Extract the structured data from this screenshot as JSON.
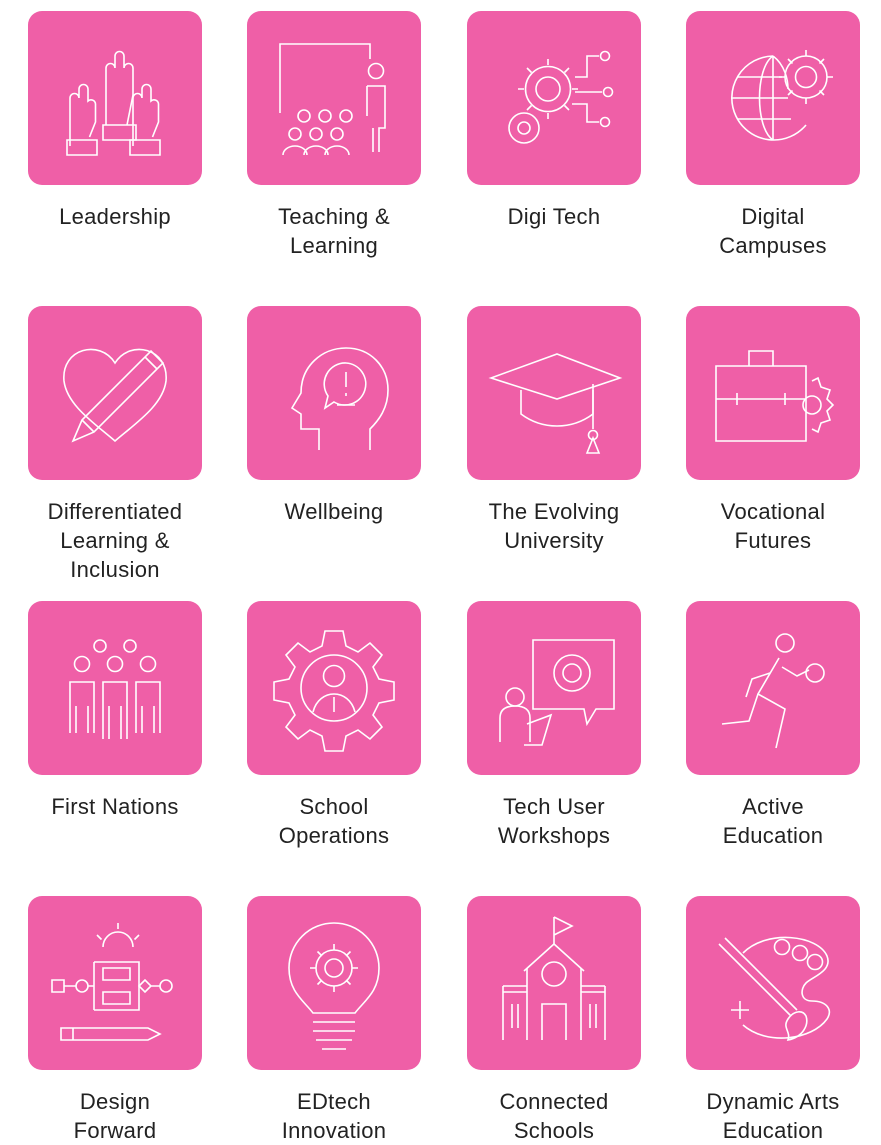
{
  "accent_color": "#ef5fa7",
  "tiles": [
    {
      "label": "Leadership",
      "icon": "raised-hands-icon"
    },
    {
      "label": "Teaching &\nLearning",
      "icon": "presentation-icon"
    },
    {
      "label": "Digi Tech",
      "icon": "gears-circuit-icon"
    },
    {
      "label": "Digital\nCampuses",
      "icon": "globe-gear-icon"
    },
    {
      "label": "Differentiated\nLearning &\nInclusion",
      "icon": "heart-pencil-icon"
    },
    {
      "label": "Wellbeing",
      "icon": "head-alert-icon"
    },
    {
      "label": "The Evolving\nUniversity",
      "icon": "graduation-cap-icon"
    },
    {
      "label": "Vocational\nFutures",
      "icon": "briefcase-gear-icon"
    },
    {
      "label": "First Nations",
      "icon": "people-group-icon"
    },
    {
      "label": "School\nOperations",
      "icon": "gear-person-icon"
    },
    {
      "label": "Tech User\nWorkshops",
      "icon": "presenter-gear-icon"
    },
    {
      "label": "Active\nEducation",
      "icon": "runner-icon"
    },
    {
      "label": "Design\nForward",
      "icon": "flowchart-icon"
    },
    {
      "label": "EDtech\nInnovation",
      "icon": "lightbulb-gear-icon"
    },
    {
      "label": "Connected\nSchools",
      "icon": "school-building-icon"
    },
    {
      "label": "Dynamic Arts\nEducation",
      "icon": "palette-brush-icon"
    }
  ]
}
